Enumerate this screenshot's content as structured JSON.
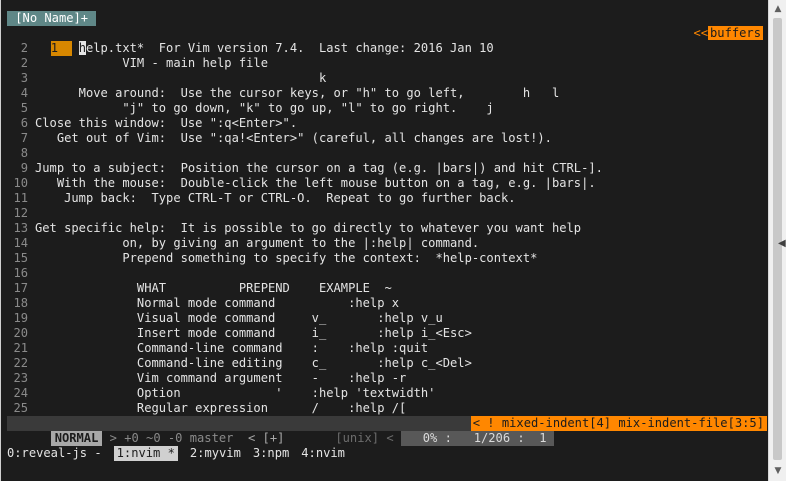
{
  "tabline": {
    "tab_label": " [No Name]+ ",
    "arrow": "<<",
    "buffers_label": "buffers"
  },
  "cursor_line": {
    "num": "1",
    "text": "help.txt*  For Vim version 7.4.  Last change: 2016 Jan 10"
  },
  "lines": [
    {
      "num": "2",
      "text": "                               "
    },
    {
      "num": "2",
      "text": "            VIM - main help file"
    },
    {
      "num": "3",
      "text": "                                       k"
    },
    {
      "num": "4",
      "text": "      Move around:  Use the cursor keys, or \"h\" to go left,        h   l"
    },
    {
      "num": "5",
      "text": "            \"j\" to go down, \"k\" to go up, \"l\" to go right.    j"
    },
    {
      "num": "6",
      "text": "Close this window:  Use \":q<Enter>\"."
    },
    {
      "num": "7",
      "text": "   Get out of Vim:  Use \":qa!<Enter>\" (careful, all changes are lost!)."
    },
    {
      "num": "8",
      "text": ""
    },
    {
      "num": "9",
      "text": "Jump to a subject:  Position the cursor on a tag (e.g. |bars|) and hit CTRL-]."
    },
    {
      "num": "10",
      "text": "   With the mouse:  Double-click the left mouse button on a tag, e.g. |bars|."
    },
    {
      "num": "11",
      "text": "    Jump back:  Type CTRL-T or CTRL-O.  Repeat to go further back."
    },
    {
      "num": "12",
      "text": ""
    },
    {
      "num": "13",
      "text": "Get specific help:  It is possible to go directly to whatever you want help"
    },
    {
      "num": "14",
      "text": "            on, by giving an argument to the |:help| command."
    },
    {
      "num": "15",
      "text": "            Prepend something to specify the context:  *help-context*"
    },
    {
      "num": "16",
      "text": ""
    },
    {
      "num": "17",
      "text": "              WHAT          PREPEND    EXAMPLE  ~"
    },
    {
      "num": "18",
      "text": "              Normal mode command          :help x"
    },
    {
      "num": "19",
      "text": "              Visual mode command     v_       :help v_u"
    },
    {
      "num": "20",
      "text": "              Insert mode command     i_       :help i_<Esc>"
    },
    {
      "num": "21",
      "text": "              Command-line command    :    :help :quit"
    },
    {
      "num": "22",
      "text": "              Command-line editing    c_       :help c_<Del>"
    },
    {
      "num": "23",
      "text": "              Vim command argument    -    :help -r"
    },
    {
      "num": "24",
      "text": "              Option             '    :help 'textwidth'"
    },
    {
      "num": "25",
      "text": "              Regular expression      /    :help /["
    }
  ],
  "statusline": {
    "mode": "NORMAL",
    "git": " > +0 ~0 -0 master ",
    "buffer": " < [+]      ",
    "fileformat": " [unix] < ",
    "position": "   0% :   1/206 :  1 ",
    "warning": "< ! mixed-indent[4] mix-indent-file[3:5]"
  },
  "tmux": {
    "windows": [
      {
        "label": "0:reveal-js -",
        "active": false
      },
      {
        "label": "1:nvim *",
        "active": true
      },
      {
        "label": "2:myvim",
        "active": false
      },
      {
        "label": "3:npm",
        "active": false
      },
      {
        "label": "4:nvim",
        "active": false
      }
    ]
  },
  "colors": {
    "background": "#1c1c1c",
    "tab_noname": "#5f8787",
    "accent_orange": "#ff8700",
    "mode_bg": "#a8a8a8"
  }
}
